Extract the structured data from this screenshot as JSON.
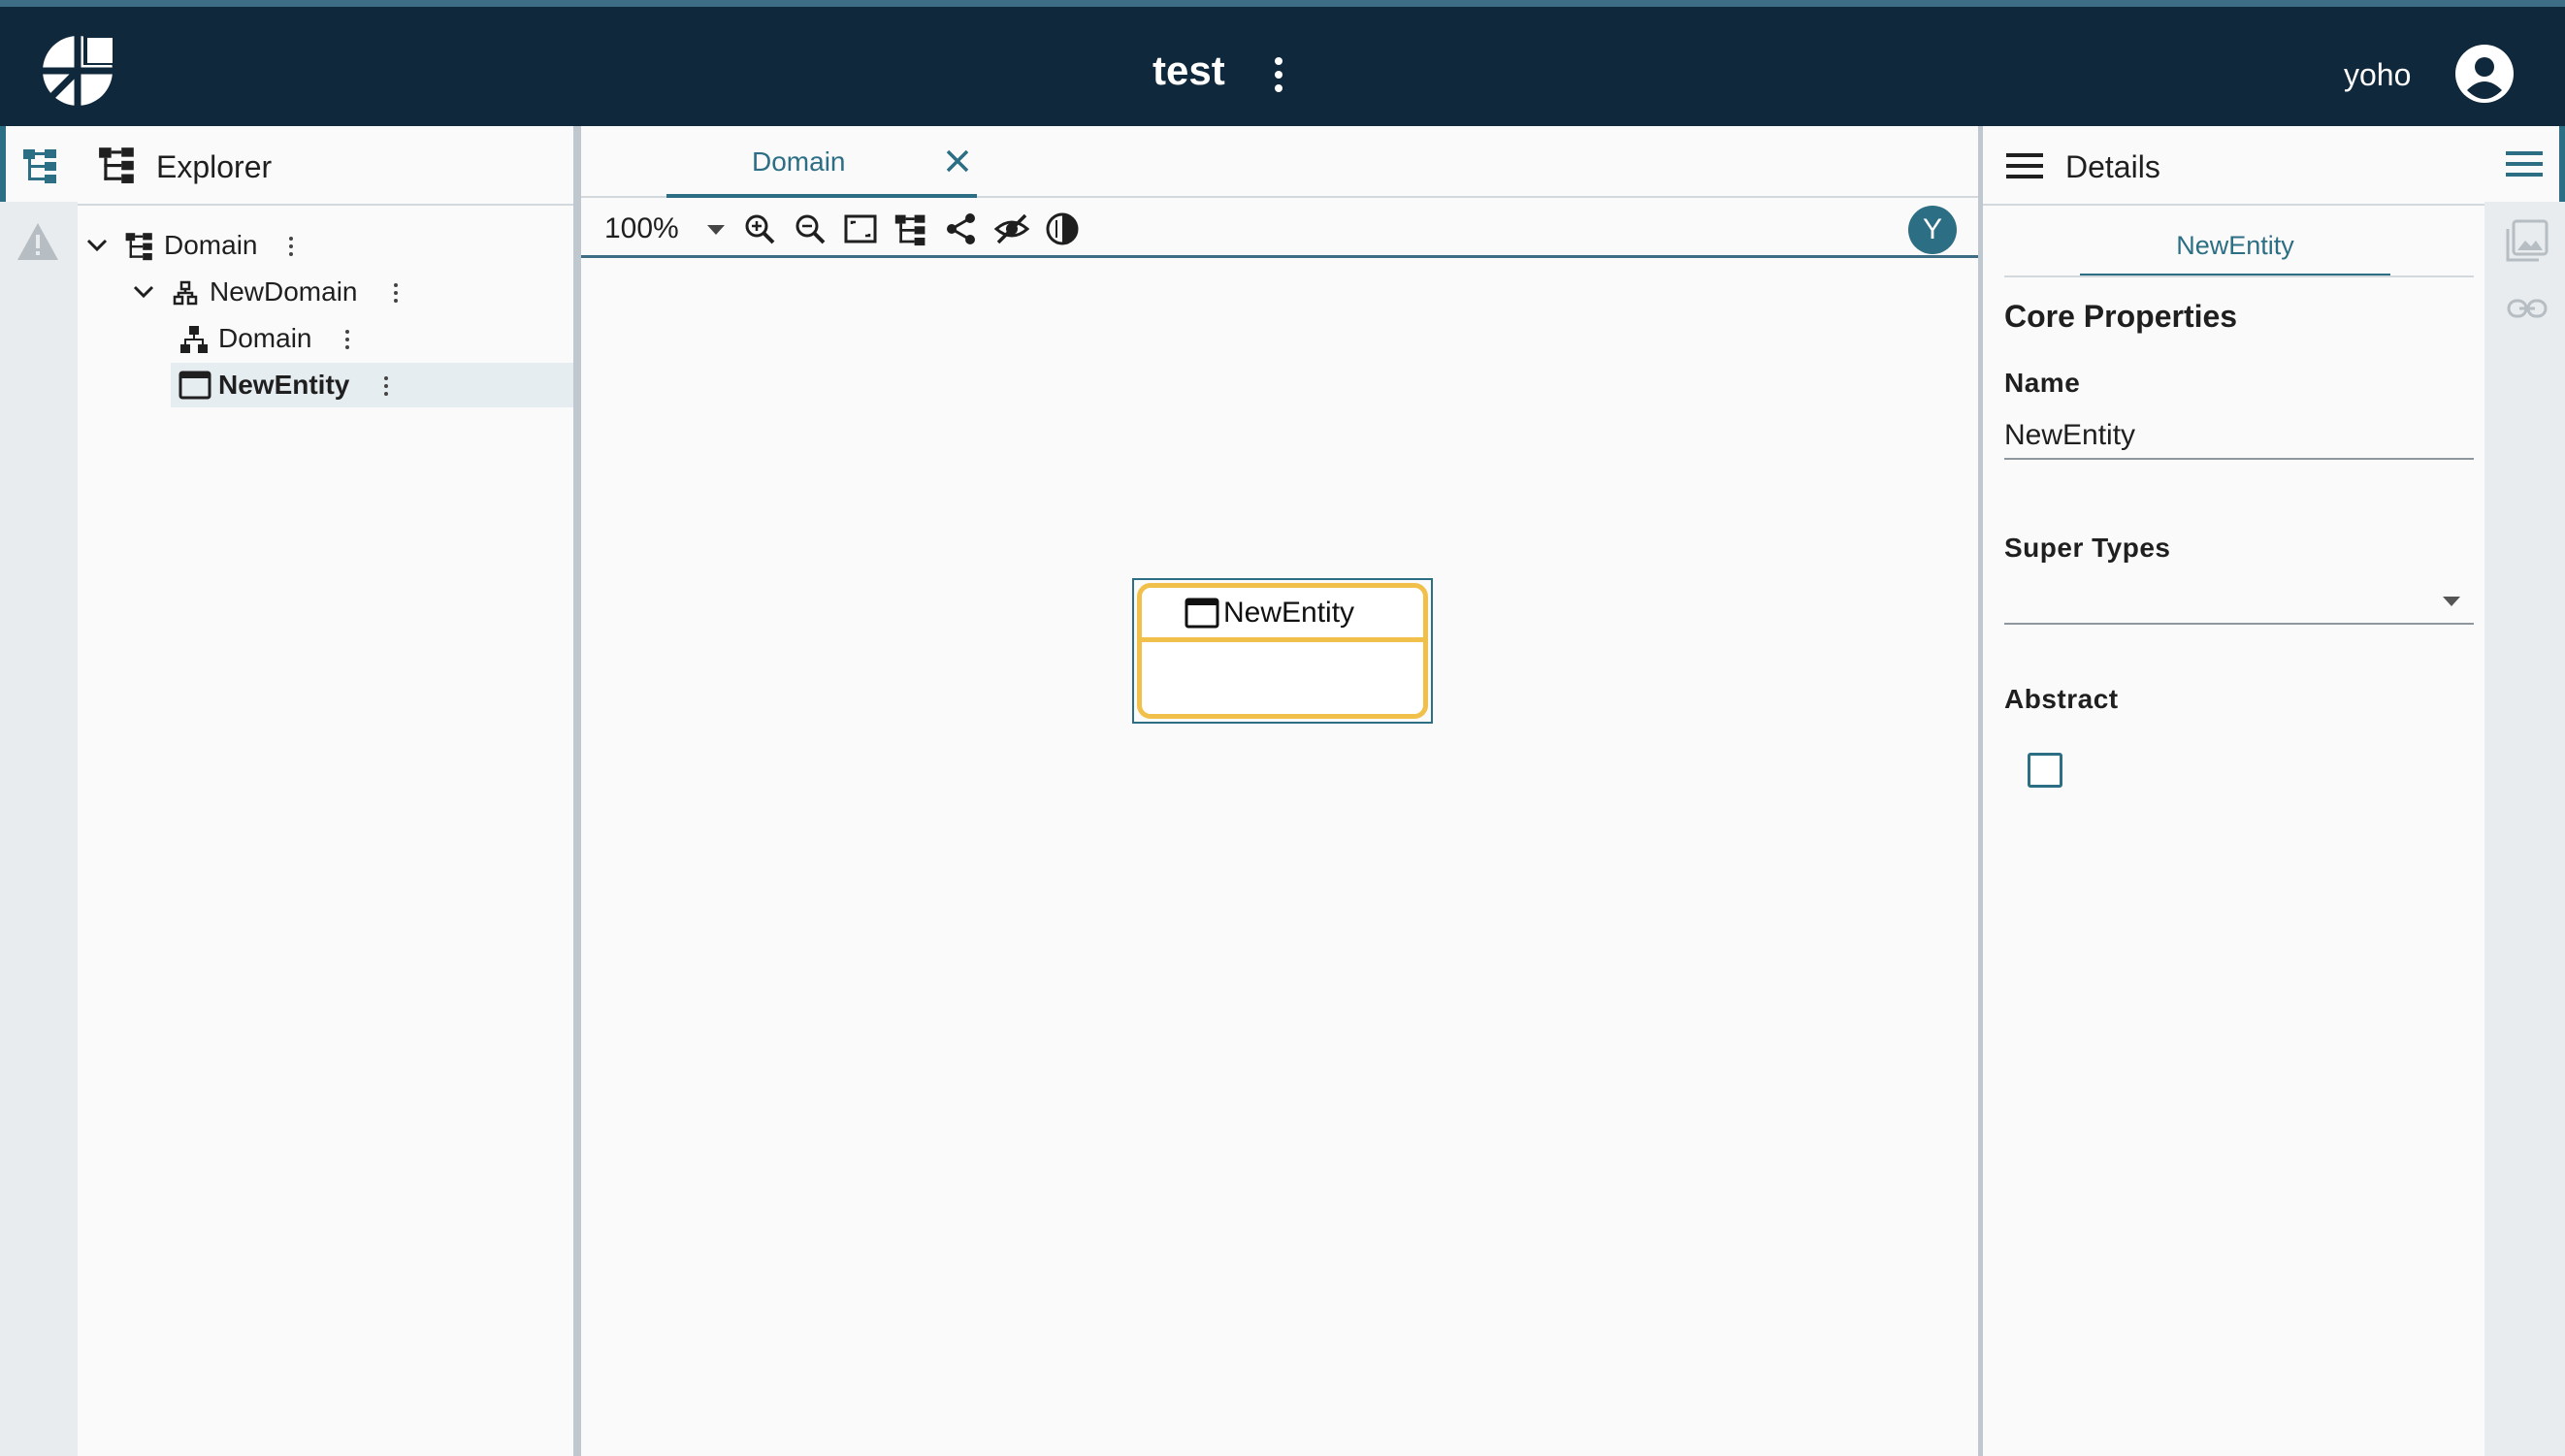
{
  "header": {
    "app_title": "test",
    "user_name": "yoho",
    "icons": [
      "logo-icon",
      "more-vert-icon",
      "account-circle-icon"
    ]
  },
  "left_rail": {
    "items": [
      {
        "name": "explorer",
        "icon": "tree-hierarchy-icon",
        "active": true
      },
      {
        "name": "problems",
        "icon": "warning-triangle-icon",
        "active": false
      }
    ]
  },
  "explorer": {
    "title": "Explorer",
    "tree": [
      {
        "label": "Domain",
        "icon": "tree-hierarchy-icon",
        "expanded": true,
        "level": 0,
        "selected": false
      },
      {
        "label": "NewDomain",
        "icon": "sitemap-icon",
        "expanded": true,
        "level": 1,
        "selected": false
      },
      {
        "label": "Domain",
        "icon": "sitemap-icon",
        "level": 2,
        "selected": false
      },
      {
        "label": "NewEntity",
        "icon": "entity-window-icon",
        "level": 2,
        "selected": true
      }
    ]
  },
  "editor": {
    "tabs": [
      {
        "label": "Domain",
        "active": true
      }
    ],
    "zoom": "100%",
    "toolbar_icons": [
      "zoom-in-icon",
      "zoom-out-icon",
      "fit-content-icon",
      "layout-icon",
      "share-icon",
      "hide-icon",
      "contrast-icon"
    ],
    "badge": "Y",
    "node": {
      "label": "NewEntity",
      "icon": "entity-window-icon"
    }
  },
  "details": {
    "title": "Details",
    "tab": "NewEntity",
    "section_title": "Core Properties",
    "fields": {
      "name_label": "Name",
      "name_value": "NewEntity",
      "super_types_label": "Super Types",
      "super_types_value": "",
      "abstract_label": "Abstract",
      "abstract_checked": false
    }
  },
  "right_rail": {
    "items": [
      "menu-lines-icon",
      "image-icon",
      "link-icon"
    ]
  },
  "colors": {
    "header_bg": "#10283b",
    "accent": "#2c6e84",
    "node_border": "#f0c04a",
    "rail_bg": "#e8ecef",
    "panel_bg": "#fafafa"
  }
}
